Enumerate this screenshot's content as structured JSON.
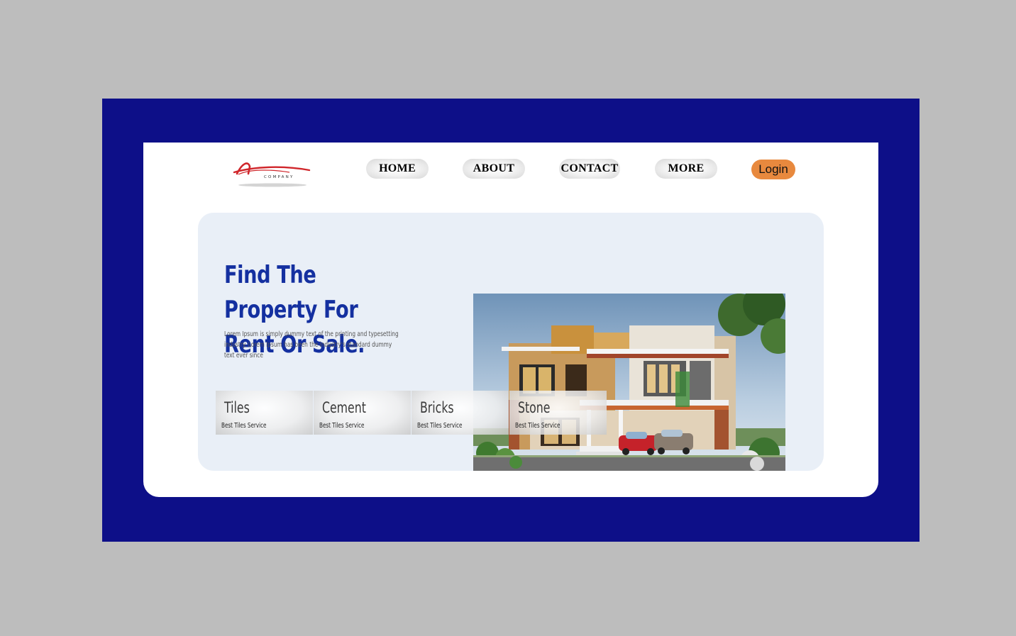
{
  "logo": {
    "text": "COMPANY",
    "colors": {
      "swoosh": "#d0262b",
      "text": "#333333"
    }
  },
  "nav": {
    "items": [
      {
        "label": "HOME"
      },
      {
        "label": "ABOUT"
      },
      {
        "label": "CONTACT"
      },
      {
        "label": "MORE"
      }
    ],
    "login_label": "Login"
  },
  "hero": {
    "title": "Find The Property For Rent Or Sale.",
    "description": "Lorem Ipsum is simply dummy text of the printing and typesetting industry. Lorem Ipsum has been the industry's standard dummy text ever since",
    "image": "modern-two-storey-house"
  },
  "services": [
    {
      "name": "Tiles",
      "subtitle": "Best Tiles Service"
    },
    {
      "name": "Cement",
      "subtitle": "Best Tiles Service"
    },
    {
      "name": "Bricks",
      "subtitle": "Best Tiles Service"
    },
    {
      "name": "Stone",
      "subtitle": "Best Tiles Service"
    }
  ],
  "colors": {
    "outer_background": "#bdbdbd",
    "frame": "#0d0f88",
    "card": "#ffffff",
    "hero_background": "#e9eff7",
    "title": "#1430a0",
    "login_button": "#e8893e"
  }
}
